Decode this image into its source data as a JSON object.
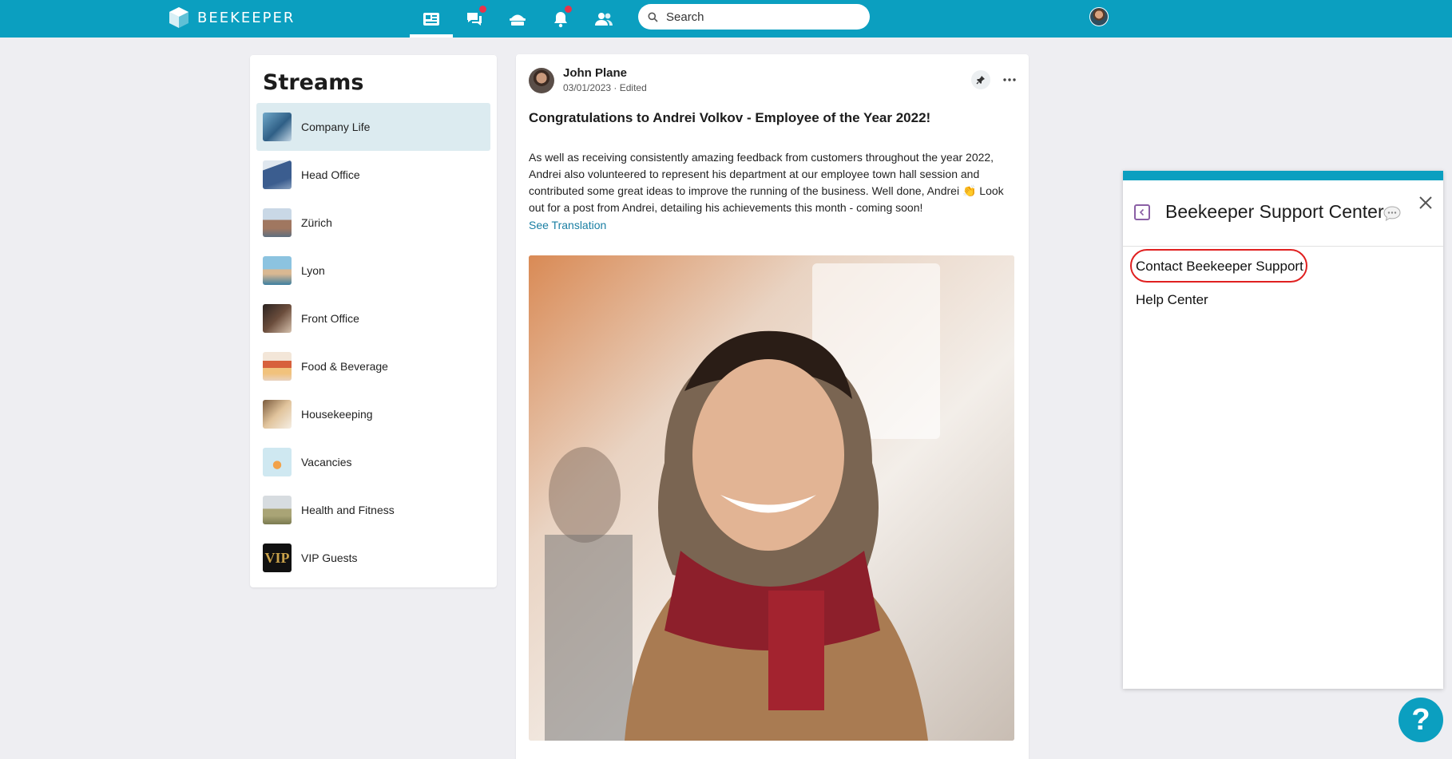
{
  "app": {
    "logo_text": "BEEKEEPER",
    "accent": "#0b9fc0"
  },
  "header": {
    "nav": [
      {
        "name": "streams-nav",
        "icon": "streams-icon",
        "active": true
      },
      {
        "name": "chats-nav",
        "icon": "chat-icon",
        "badge": true
      },
      {
        "name": "tools-nav",
        "icon": "toolbox-icon"
      },
      {
        "name": "notifications-nav",
        "icon": "bell-icon",
        "badge": true
      },
      {
        "name": "people-nav",
        "icon": "people-icon"
      }
    ],
    "search_placeholder": "Search"
  },
  "streams": {
    "title": "Streams",
    "items": [
      {
        "label": "Company Life",
        "active": true
      },
      {
        "label": "Head Office"
      },
      {
        "label": "Zürich"
      },
      {
        "label": "Lyon"
      },
      {
        "label": "Front Office"
      },
      {
        "label": "Food & Beverage"
      },
      {
        "label": "Housekeeping"
      },
      {
        "label": "Vacancies"
      },
      {
        "label": "Health and Fitness"
      },
      {
        "label": "VIP Guests"
      }
    ]
  },
  "post": {
    "author": "John Plane",
    "date": "03/01/2023",
    "edited": "Edited",
    "title": "Congratulations to Andrei Volkov - Employee of the Year 2022!",
    "body_before_emoji": "As well as receiving consistently amazing feedback from customers throughout the year 2022, Andrei also volunteered to represent his department at our employee town hall session and contributed some great ideas to improve the running of the business. Well done, Andrei ",
    "emoji": "👏",
    "body_after_emoji": " Look out for a post from Andrei, detailing his achievements this month - coming soon!",
    "see_translation": "See Translation"
  },
  "support_panel": {
    "title": "Beekeeper Support Center",
    "links": [
      "Contact Beekeeper Support",
      "Help Center"
    ]
  },
  "help_fab": "?"
}
